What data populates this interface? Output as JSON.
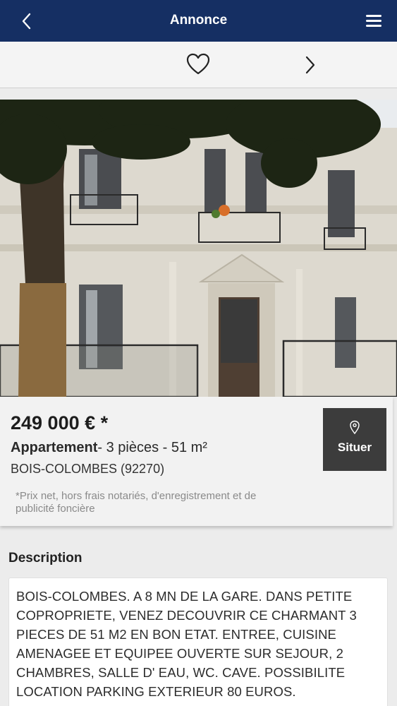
{
  "header": {
    "title": "Annonce"
  },
  "listing": {
    "price": "249 000 € *",
    "property_type": "Appartement",
    "details": "- 3 pièces - 51 m²",
    "location": "BOIS-COLOMBES (92270)",
    "disclaimer": "*Prix net, hors frais notariés, d'enregistrement et de publicité foncière",
    "locate_button": "Situer"
  },
  "description": {
    "heading": "Description",
    "text": "BOIS-COLOMBES. A 8 MN DE LA GARE. DANS PETITE COPROPRIETE, VENEZ DECOUVRIR CE CHARMANT 3 PIECES DE 51 M2 EN BON ETAT. ENTREE, CUISINE AMENAGEE ET EQUIPEE OUVERTE SUR SEJOUR, 2 CHAMBRES, SALLE D' EAU, WC. CAVE. POSSIBILITE LOCATION PARKING EXTERIEUR 80 EUROS."
  },
  "icons": {
    "back": "chevron-left-icon",
    "menu": "hamburger-menu-icon",
    "favorite": "heart-outline-icon",
    "next": "chevron-right-icon",
    "locate": "map-pin-icon"
  },
  "colors": {
    "header_bg": "#152f63",
    "locate_button_bg": "#3c3c3c"
  }
}
